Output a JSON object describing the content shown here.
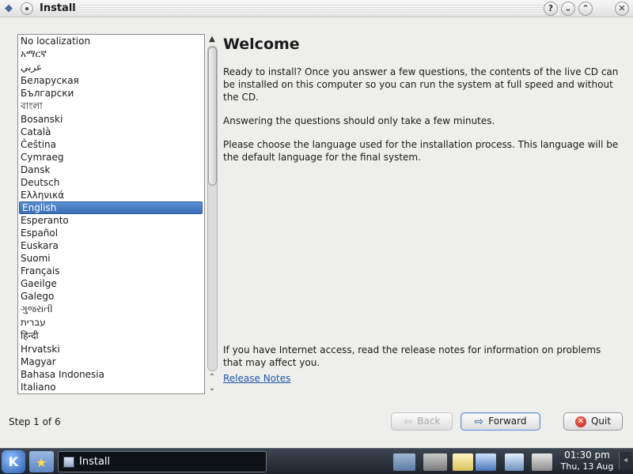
{
  "window": {
    "title": "Install",
    "help_glyph": "?",
    "minimize_glyph": "⌄",
    "maximize_glyph": "⌃",
    "close_glyph": "✕",
    "menu_icon": "kde-window-menu-icon",
    "sticky_icon": "pin-icon"
  },
  "languages": [
    "No localization",
    "አማርኛ",
    "عربي",
    "Беларуская",
    "Български",
    "বাংলা",
    "Bosanski",
    "Català",
    "Čeština",
    "Cymraeg",
    "Dansk",
    "Deutsch",
    "Ελληνικά",
    "English",
    "Esperanto",
    "Español",
    "Euskara",
    "Suomi",
    "Français",
    "Gaeilge",
    "Galego",
    "ગુજરાતી",
    "עברית",
    "हिन्दी",
    "Hrvatski",
    "Magyar",
    "Bahasa Indonesia",
    "Italiano"
  ],
  "selected_language": "English",
  "main": {
    "heading": "Welcome",
    "para1": "Ready to install? Once you answer a few questions, the contents of the live CD can be installed on this computer so you can run the system at full speed and without the CD.",
    "para2": "Answering the questions should only take a few minutes.",
    "para3": "Please choose the language used for the installation process. This language will be the default language for the final system.",
    "para4": "If you have Internet access, read the release notes for information on problems that may affect you.",
    "release_notes": "Release Notes"
  },
  "footer": {
    "step": "Step 1 of 6",
    "back": "Back",
    "forward": "Forward",
    "quit": "Quit",
    "back_enabled": false
  },
  "taskbar": {
    "kmenu_glyph": "K",
    "task_label": "Install",
    "clock_time": "01:30 pm",
    "clock_date": "Thu, 13 Aug",
    "tray_end_glyph": "◂"
  },
  "colors": {
    "selection": "#3a6fb8",
    "link": "#1f57a8",
    "taskbar": "#1e242c"
  }
}
